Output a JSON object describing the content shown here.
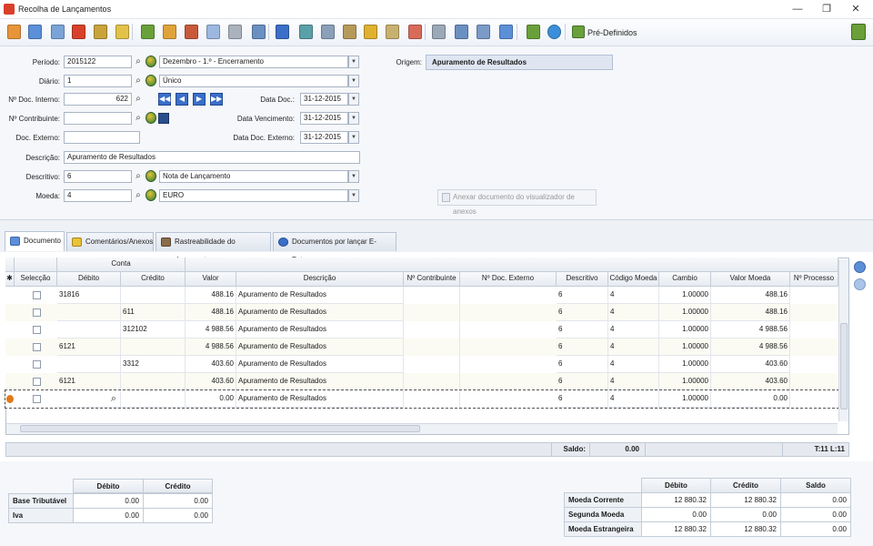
{
  "window": {
    "title": "Recolha de Lançamentos",
    "min": "—",
    "restore": "❐",
    "close": "✕"
  },
  "toolbar": {
    "predefinidos_label": "Pré-Definidos",
    "icons": [
      "grid-icon",
      "window-icon",
      "window2-icon",
      "delete-doc-icon",
      "cut-icon",
      "clear-icon",
      "copy-doc-icon",
      "users-icon",
      "recycle-icon",
      "documents-icon",
      "stop-icon",
      "edit-doc-icon",
      "down-arrow-icon",
      "import-icon",
      "export-icon",
      "paste-icon",
      "coins-icon",
      "ledger-icon",
      "reconcile-icon",
      "print-icon",
      "report-icon",
      "chart-icon",
      "preview-icon",
      "undo-icon",
      "help-icon"
    ],
    "accent": "#3a6fc8"
  },
  "form": {
    "periodo": {
      "label": "Período:",
      "value": "2015122",
      "desc": "Dezembro - 1.º - Encerramento"
    },
    "diario": {
      "label": "Diário:",
      "value": "1",
      "desc": "Único"
    },
    "doc_interno": {
      "label": "Nº Doc. Interno:",
      "value": "622"
    },
    "contribuinte": {
      "label": "Nº Contribuinte:",
      "value": ""
    },
    "doc_externo": {
      "label": "Doc. Externo:",
      "value": ""
    },
    "descricao": {
      "label": "Descrição:",
      "value": "Apuramento de Resultados"
    },
    "descritivo": {
      "label": "Descritivo:",
      "value": "6",
      "desc": "Nota de Lançamento"
    },
    "moeda": {
      "label": "Moeda:",
      "value": "4",
      "desc": "EURO"
    },
    "data_doc": {
      "label": "Data Doc.:",
      "value": "31-12-2015"
    },
    "data_vencimento": {
      "label": "Data Vencimento:",
      "value": "31-12-2015"
    },
    "data_doc_externo": {
      "label": "Data Doc. Externo:",
      "value": "31-12-2015"
    },
    "origem": {
      "label": "Origem:",
      "value": "Apuramento de Resultados"
    },
    "anexar_label": "Anexar documento do visualizador de anexos",
    "nav": [
      "◀◀",
      "◀",
      "▶",
      "▶▶"
    ]
  },
  "tabs": [
    {
      "label": "Documento",
      "active": true
    },
    {
      "label": "Comentários/Anexos",
      "active": false
    },
    {
      "label": "Rastreabilidade do documento",
      "active": false
    },
    {
      "label": "Documentos por lançar E-Fatura",
      "active": false
    }
  ],
  "grid": {
    "group_header": "Conta",
    "columns": [
      "Selecção",
      "Débito",
      "Crédito",
      "Valor",
      "Descrição",
      "Nº Contribuinte",
      "Nº Doc. Externo",
      "Descritivo",
      "Código Moeda",
      "Cambio",
      "Valor Moeda Estrangeira",
      "Nº Processo"
    ],
    "rows": [
      {
        "debito": "31816",
        "credito": "",
        "valor": "488.16",
        "descricao": "Apuramento de Resultados",
        "descritivo": "6",
        "moeda": "4",
        "cambio": "1.00000",
        "vme": "488.16"
      },
      {
        "debito": "",
        "credito": "611",
        "valor": "488.16",
        "descricao": "Apuramento de Resultados",
        "descritivo": "6",
        "moeda": "4",
        "cambio": "1.00000",
        "vme": "488.16"
      },
      {
        "debito": "",
        "credito": "312102",
        "valor": "4 988.56",
        "descricao": "Apuramento de Resultados",
        "descritivo": "6",
        "moeda": "4",
        "cambio": "1.00000",
        "vme": "4 988.56"
      },
      {
        "debito": "6121",
        "credito": "",
        "valor": "4 988.56",
        "descricao": "Apuramento de Resultados",
        "descritivo": "6",
        "moeda": "4",
        "cambio": "1.00000",
        "vme": "4 988.56"
      },
      {
        "debito": "",
        "credito": "3312",
        "valor": "403.60",
        "descricao": "Apuramento de Resultados",
        "descritivo": "6",
        "moeda": "4",
        "cambio": "1.00000",
        "vme": "403.60"
      },
      {
        "debito": "6121",
        "credito": "",
        "valor": "403.60",
        "descricao": "Apuramento de Resultados",
        "descritivo": "6",
        "moeda": "4",
        "cambio": "1.00000",
        "vme": "403.60"
      },
      {
        "debito": "",
        "credito": "",
        "valor": "0.00",
        "descricao": "Apuramento de Resultados",
        "descritivo": "6",
        "moeda": "4",
        "cambio": "1.00000",
        "vme": "0.00"
      }
    ],
    "row_marker": "✱"
  },
  "saldo": {
    "label": "Saldo:",
    "value": "0.00",
    "position": "T:11 L:11"
  },
  "tax_table": {
    "headers": [
      "Débito",
      "Crédito"
    ],
    "rows": [
      {
        "label": "Base Tributável",
        "debito": "0.00",
        "credito": "0.00"
      },
      {
        "label": "Iva",
        "debito": "0.00",
        "credito": "0.00"
      }
    ]
  },
  "totals_table": {
    "headers": [
      "Débito",
      "Crédito",
      "Saldo"
    ],
    "rows": [
      {
        "label": "Moeda Corrente",
        "debito": "12 880.32",
        "credito": "12 880.32",
        "saldo": "0.00"
      },
      {
        "label": "Segunda Moeda",
        "debito": "0.00",
        "credito": "0.00",
        "saldo": "0.00"
      },
      {
        "label": "Moeda Estrangeira",
        "debito": "12 880.32",
        "credito": "12 880.32",
        "saldo": "0.00"
      }
    ]
  }
}
